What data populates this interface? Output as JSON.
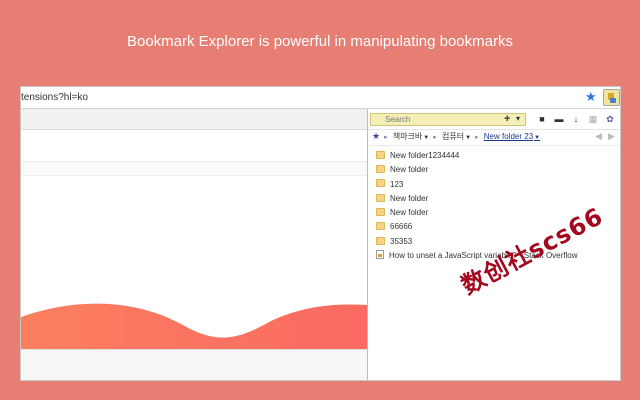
{
  "headline": "Bookmark Explorer is powerful in manipulating bookmarks",
  "omnibox": {
    "url": "tensions?hl=ko"
  },
  "popup": {
    "search_placeholder": "Search",
    "plus_label": "+",
    "caret_label": "▾",
    "breadcrumbs": [
      {
        "label": "책마크바"
      },
      {
        "label": "컴퓨터"
      },
      {
        "label": "New folder 23"
      }
    ],
    "items": [
      {
        "label": "New folder1234444",
        "icon": "folder-icon"
      },
      {
        "label": "New folder",
        "icon": "folder-icon"
      },
      {
        "label": "123",
        "icon": "folder-icon"
      },
      {
        "label": "New folder",
        "icon": "folder-icon"
      },
      {
        "label": "New folder",
        "icon": "folder-icon"
      },
      {
        "label": "66666",
        "icon": "folder-icon"
      },
      {
        "label": "35353",
        "icon": "folder-icon"
      },
      {
        "label": "How to unset a JavaScript variable? - Stack Overflow",
        "icon": "page-icon"
      }
    ]
  },
  "watermark": "数创社scs66",
  "colors": {
    "background": "#e67e73",
    "search_bg": "#f4efb7",
    "folder": "#f4d586",
    "star": "#2b78e4",
    "watermark": "#a3081e"
  }
}
